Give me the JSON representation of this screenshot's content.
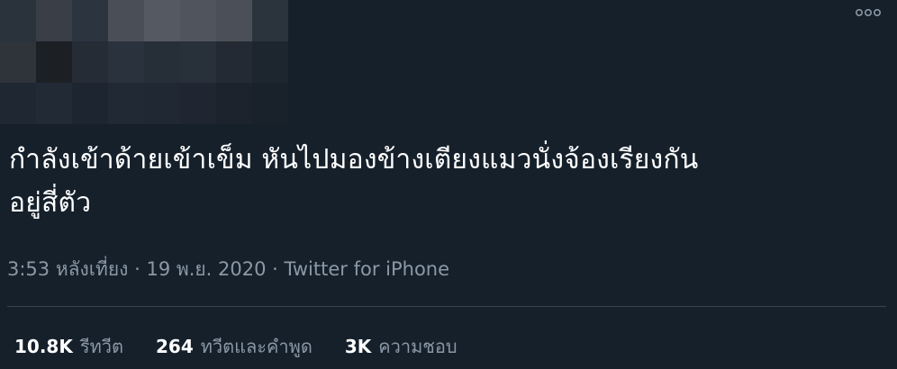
{
  "tweet": {
    "text_line1": "กำลังเข้าด้ายเข้าเข็ม หันไปมองข้างเตียงแมวนั่งจ้องเรียงกัน",
    "text_line2": "อยู่สี่ตัว",
    "time": "3:53 หลังเที่ยง",
    "separator": "·",
    "date": "19 พ.ย. 2020",
    "source": "Twitter for iPhone"
  },
  "stats": {
    "retweets": {
      "count": "10.8K",
      "label": "รีทวีต"
    },
    "quotes": {
      "count": "264",
      "label": "ทวีตและคำพูด"
    },
    "likes": {
      "count": "3K",
      "label": "ความชอบ"
    }
  },
  "colors": {
    "background": "#15202b",
    "text": "#ffffff",
    "secondary_text": "#8b98a5",
    "divider": "#38444d"
  },
  "icons": {
    "more": "more-options-icon"
  }
}
